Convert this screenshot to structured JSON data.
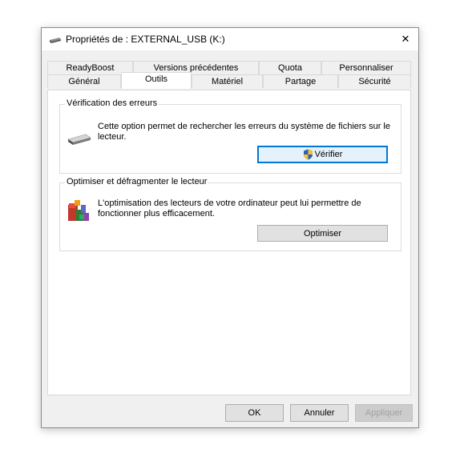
{
  "window": {
    "title": "Propriétés de : EXTERNAL_USB (K:)",
    "close_symbol": "✕"
  },
  "tabs": {
    "row1": [
      "ReadyBoost",
      "Versions précédentes",
      "Quota",
      "Personnaliser"
    ],
    "row2": [
      "Général",
      "Outils",
      "Matériel",
      "Partage",
      "Sécurité"
    ],
    "active": "Outils"
  },
  "error_check": {
    "title": "Vérification des erreurs",
    "description_line1": "Cette option permet de rechercher les erreurs du système de fichiers sur le",
    "description_line2": "lecteur.",
    "button_label": "Vérifier",
    "icon": "drive-icon"
  },
  "optimize": {
    "title": "Optimiser et défragmenter le lecteur",
    "description_line1": "L'optimisation des lecteurs de votre ordinateur peut lui permettre de",
    "description_line2": "fonctionner plus efficacement.",
    "button_label": "Optimiser",
    "icon": "defrag-icon"
  },
  "footer": {
    "ok_label": "OK",
    "cancel_label": "Annuler",
    "apply_label": "Appliquer"
  },
  "colors": {
    "focus_border": "#0078d7",
    "dialog_bg": "#f0f0f0",
    "panel_bg": "#ffffff"
  }
}
